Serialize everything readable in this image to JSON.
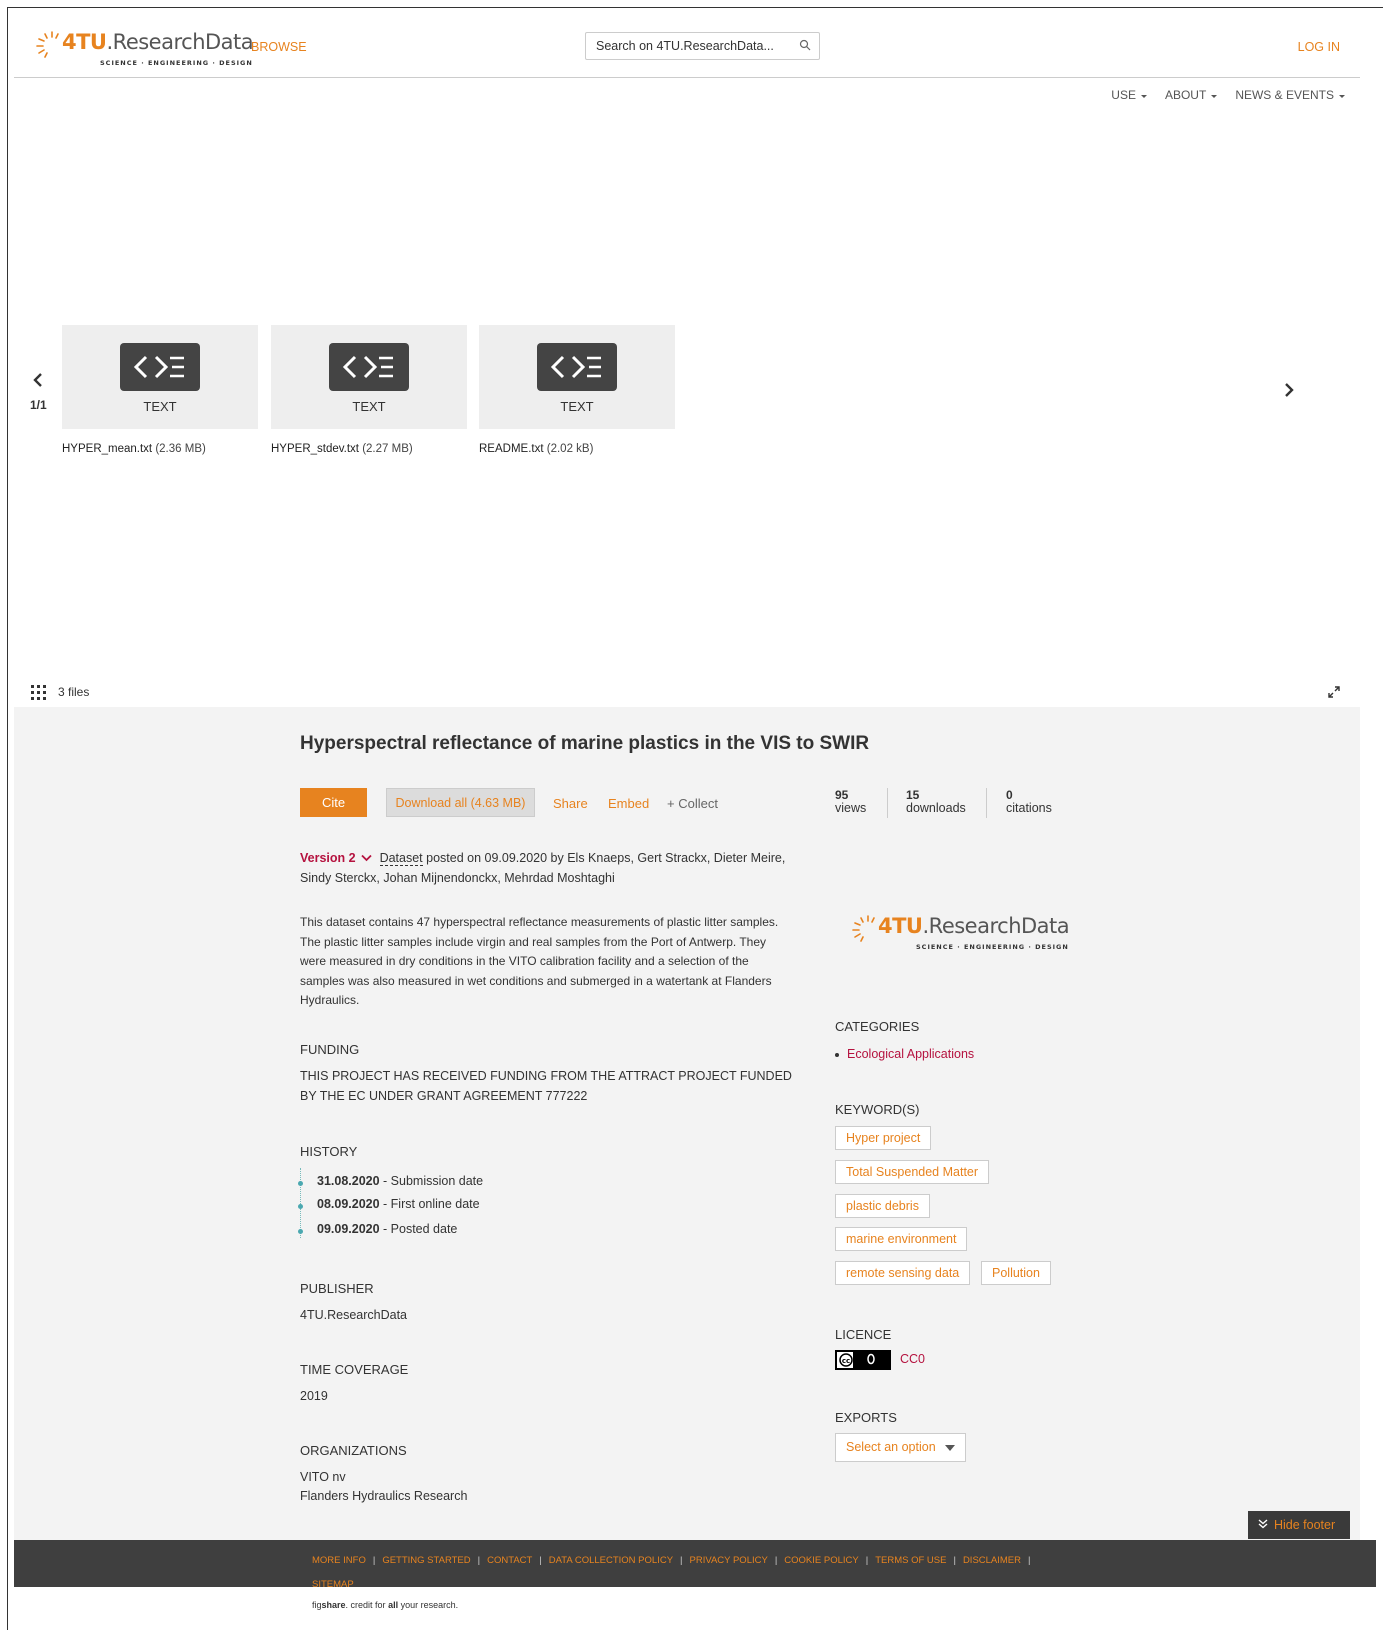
{
  "header": {
    "logo_main": "4TU",
    "logo_rest": ".ResearchData",
    "logo_sub": "SCIENCE · ENGINEERING · DESIGN",
    "browse": "BROWSE",
    "search_placeholder": "Search on 4TU.ResearchData...",
    "login": "LOG IN"
  },
  "nav": [
    "USE",
    "ABOUT",
    "NEWS & EVENTS"
  ],
  "viewer": {
    "page": "1/1",
    "files": [
      {
        "type": "TEXT",
        "name": "HYPER_mean.txt",
        "size": "(2.36 MB)"
      },
      {
        "type": "TEXT",
        "name": "HYPER_stdev.txt",
        "size": "(2.27 MB)"
      },
      {
        "type": "TEXT",
        "name": "README.txt",
        "size": "(2.02 kB)"
      }
    ],
    "count": "3 files"
  },
  "item": {
    "title": "Hyperspectral reflectance of marine plastics in the VIS to SWIR",
    "cite": "Cite",
    "download": "Download all (4.63 MB)",
    "share": "Share",
    "embed": "Embed",
    "collect": "+ Collect",
    "stats": [
      {
        "value": "95",
        "label": "views"
      },
      {
        "value": "15",
        "label": "downloads"
      },
      {
        "value": "0",
        "label": "citations"
      }
    ],
    "version": "Version 2",
    "type": "Dataset",
    "posted": " posted on 09.09.2020 by Els Knaeps, Gert Strackx, Dieter Meire, Sindy Sterckx, Johan Mijnendonckx, Mehrdad Moshtaghi",
    "description": "This dataset contains 47 hyperspectral reflectance measurements of plastic litter samples. The plastic litter samples include virgin and real samples from the Port of Antwerp. They were measured in dry conditions in the VITO calibration facility and a selection of the samples was also measured in wet conditions and submerged in a watertank at Flanders Hydraulics.",
    "funding_h": "FUNDING",
    "funding": "THIS PROJECT HAS RECEIVED FUNDING FROM THE ATTRACT PROJECT FUNDED BY THE EC UNDER GRANT AGREEMENT 777222",
    "history_h": "HISTORY",
    "history": [
      {
        "date": "31.08.2020",
        "label": " - Submission date"
      },
      {
        "date": "08.09.2020",
        "label": " - First online date"
      },
      {
        "date": "09.09.2020",
        "label": " - Posted date"
      }
    ],
    "publisher_h": "PUBLISHER",
    "publisher": "4TU.ResearchData",
    "time_h": "TIME COVERAGE",
    "time": "2019",
    "org_h": "ORGANIZATIONS",
    "org1": "VITO nv",
    "org2": "Flanders Hydraulics Research",
    "categories_h": "CATEGORIES",
    "category": "Ecological Applications",
    "keywords_h": "KEYWORD(S)",
    "keywords": [
      "Hyper project",
      "Total Suspended Matter",
      "plastic debris",
      "marine environment",
      "remote sensing data",
      "Pollution"
    ],
    "licence_h": "LICENCE",
    "licence": "CC0",
    "exports_h": "EXPORTS",
    "exports_select": "Select an option"
  },
  "footer": {
    "hide": "Hide footer",
    "links": [
      "MORE INFO",
      "GETTING STARTED",
      "CONTACT",
      "DATA COLLECTION POLICY",
      "PRIVACY POLICY",
      "COOKIE POLICY",
      "TERMS OF USE",
      "DISCLAIMER",
      "SITEMAP"
    ],
    "credit_a": "fig",
    "credit_b": "share",
    "credit_c": ". credit for ",
    "credit_d": "all",
    "credit_e": " your research."
  },
  "colors": {
    "accent": "#e7831f",
    "link": "#b5123f",
    "panel": "#f3f3f3",
    "footer": "#3f3f3f"
  }
}
